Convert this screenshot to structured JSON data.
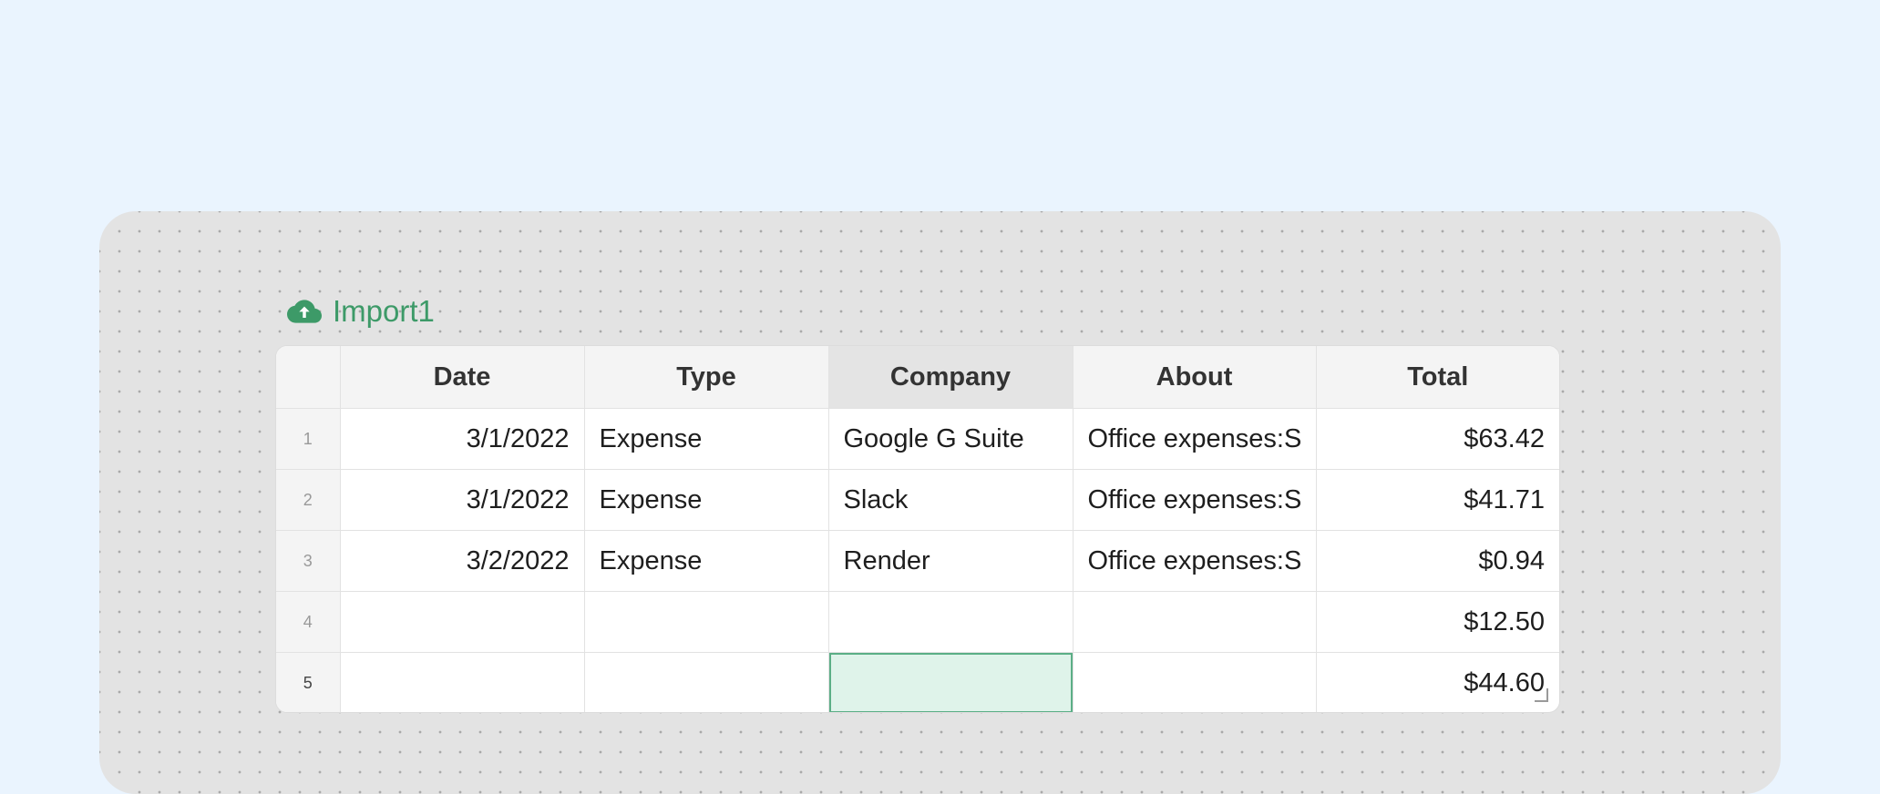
{
  "import": {
    "title": "Import1",
    "icon": "cloud-upload-icon",
    "accent_color": "#3d9a68"
  },
  "table": {
    "columns": [
      "Date",
      "Type",
      "Company",
      "About",
      "Total"
    ],
    "rows": [
      {
        "num": "1",
        "date": "3/1/2022",
        "type": "Expense",
        "company": "Google G Suite",
        "about": "Office expenses:S",
        "total": "$63.42"
      },
      {
        "num": "2",
        "date": "3/1/2022",
        "type": "Expense",
        "company": "Slack",
        "about": "Office expenses:S",
        "total": "$41.71"
      },
      {
        "num": "3",
        "date": "3/2/2022",
        "type": "Expense",
        "company": "Render",
        "about": "Office expenses:S",
        "total": "$0.94"
      },
      {
        "num": "4",
        "date": "",
        "type": "",
        "company": "",
        "about": "",
        "total": "$12.50"
      },
      {
        "num": "5",
        "date": "",
        "type": "",
        "company": "",
        "about": "",
        "total": "$44.60"
      }
    ],
    "selection": {
      "row": 5,
      "column": "Company",
      "color": "#5bae86"
    }
  }
}
